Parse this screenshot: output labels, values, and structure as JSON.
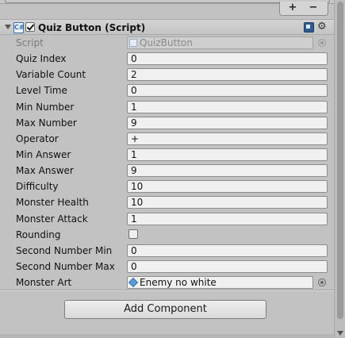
{
  "list_controls": {
    "plus_label": "+",
    "minus_label": "−"
  },
  "component": {
    "title": "Quiz Button (Script)",
    "enabled": true,
    "script_icon_label": "C#",
    "script_field": {
      "label": "Script",
      "value": "QuizButton"
    }
  },
  "properties": [
    {
      "label": "Quiz Index",
      "value": "0"
    },
    {
      "label": "Variable Count",
      "value": "2"
    },
    {
      "label": "Level Time",
      "value": "0"
    },
    {
      "label": "Min Number",
      "value": "1"
    },
    {
      "label": "Max Number",
      "value": "9"
    },
    {
      "label": "Operator",
      "value": "+"
    },
    {
      "label": "Min Answer",
      "value": "1"
    },
    {
      "label": "Max Answer",
      "value": "9"
    },
    {
      "label": "Difficulty",
      "value": "10"
    },
    {
      "label": "Monster Health",
      "value": "10"
    },
    {
      "label": "Monster Attack",
      "value": "1"
    }
  ],
  "rounding": {
    "label": "Rounding",
    "checked": false
  },
  "properties_after": [
    {
      "label": "Second Number Min",
      "value": "0"
    },
    {
      "label": "Second Number Max",
      "value": "0"
    }
  ],
  "monster_art": {
    "label": "Monster Art",
    "value": "Enemy no white"
  },
  "add_component_label": "Add Component",
  "colors": {
    "panel_bg": "#c2c2c2",
    "field_bg": "#f0f0f0",
    "prefab_icon": "#5a9ad6",
    "help_icon": "#2f5b8f"
  }
}
